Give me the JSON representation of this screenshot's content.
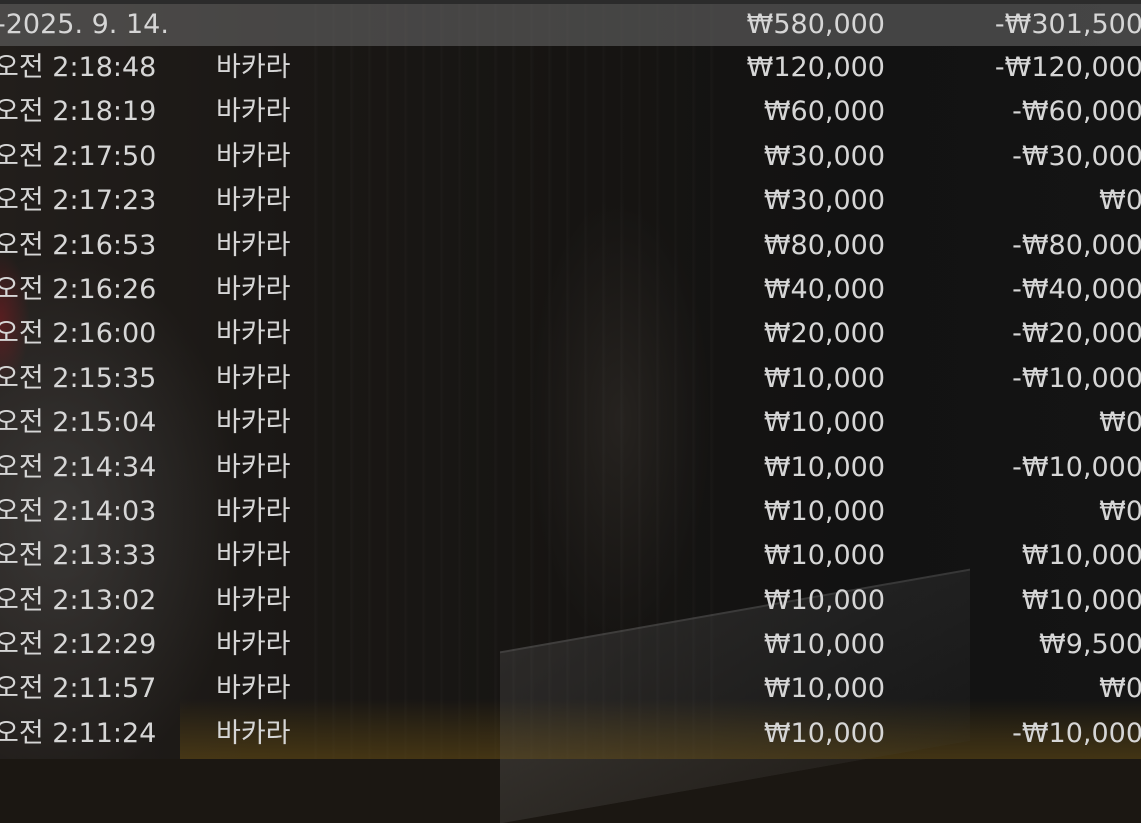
{
  "summary": {
    "date": "-2025. 9. 14.",
    "bet": "₩580,000",
    "result": "-₩301,500"
  },
  "rows": [
    {
      "time": "오전 2:18:48",
      "game": "바카라",
      "bet": "₩120,000",
      "result": "-₩120,000"
    },
    {
      "time": "오전 2:18:19",
      "game": "바카라",
      "bet": "₩60,000",
      "result": "-₩60,000"
    },
    {
      "time": "오전 2:17:50",
      "game": "바카라",
      "bet": "₩30,000",
      "result": "-₩30,000"
    },
    {
      "time": "오전 2:17:23",
      "game": "바카라",
      "bet": "₩30,000",
      "result": "₩0"
    },
    {
      "time": "오전 2:16:53",
      "game": "바카라",
      "bet": "₩80,000",
      "result": "-₩80,000"
    },
    {
      "time": "오전 2:16:26",
      "game": "바카라",
      "bet": "₩40,000",
      "result": "-₩40,000"
    },
    {
      "time": "오전 2:16:00",
      "game": "바카라",
      "bet": "₩20,000",
      "result": "-₩20,000"
    },
    {
      "time": "오전 2:15:35",
      "game": "바카라",
      "bet": "₩10,000",
      "result": "-₩10,000"
    },
    {
      "time": "오전 2:15:04",
      "game": "바카라",
      "bet": "₩10,000",
      "result": "₩0"
    },
    {
      "time": "오전 2:14:34",
      "game": "바카라",
      "bet": "₩10,000",
      "result": "-₩10,000"
    },
    {
      "time": "오전 2:14:03",
      "game": "바카라",
      "bet": "₩10,000",
      "result": "₩0"
    },
    {
      "time": "오전 2:13:33",
      "game": "바카라",
      "bet": "₩10,000",
      "result": "₩10,000"
    },
    {
      "time": "오전 2:13:02",
      "game": "바카라",
      "bet": "₩10,000",
      "result": "₩10,000"
    },
    {
      "time": "오전 2:12:29",
      "game": "바카라",
      "bet": "₩10,000",
      "result": "₩9,500"
    },
    {
      "time": "오전 2:11:57",
      "game": "바카라",
      "bet": "₩10,000",
      "result": "₩0"
    },
    {
      "time": "오전 2:11:24",
      "game": "바카라",
      "bet": "₩10,000",
      "result": "-₩10,000"
    }
  ]
}
